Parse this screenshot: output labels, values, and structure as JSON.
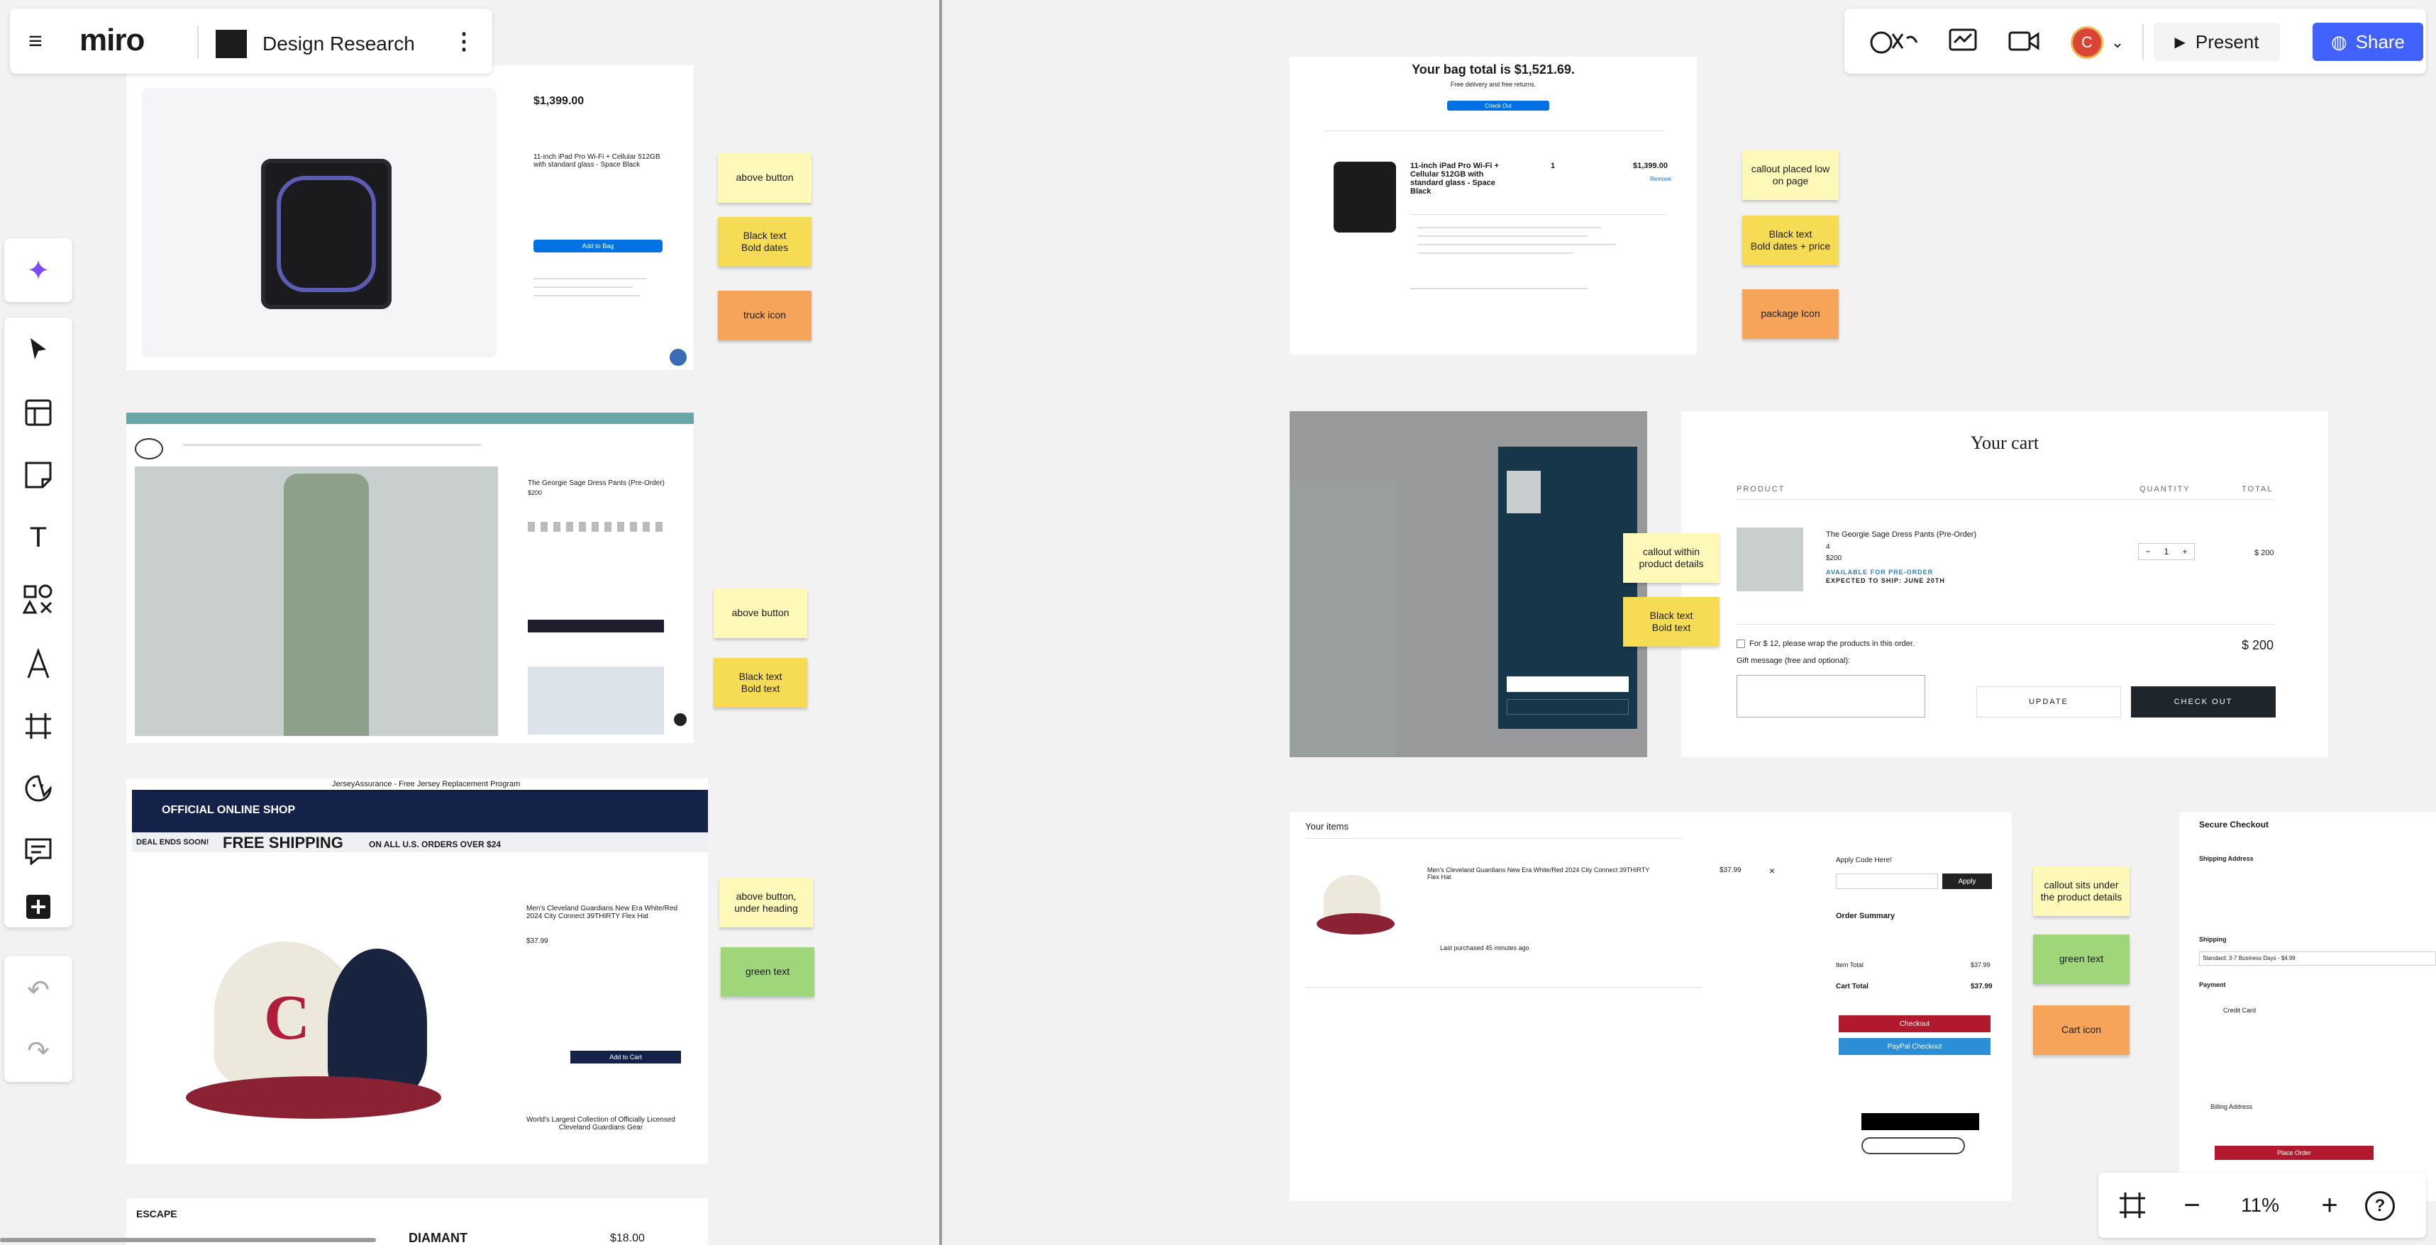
{
  "board": {
    "logo": "miro",
    "title": "Design Research"
  },
  "header": {
    "present_label": "Present",
    "share_label": "Share",
    "avatar_initial": "C"
  },
  "zoom": {
    "level": "11%"
  },
  "stickies": [
    {
      "text": "above  button",
      "color": "yellow"
    },
    {
      "text": "Black text\nBold dates",
      "color": "gold"
    },
    {
      "text": "truck icon",
      "color": "orange"
    },
    {
      "text": "above  button",
      "color": "yellow"
    },
    {
      "text": "Black text\nBold text",
      "color": "gold"
    },
    {
      "text": "above  button,\nunder heading",
      "color": "yellow"
    },
    {
      "text": "green text",
      "color": "green"
    },
    {
      "text": "callout placed low\non page",
      "color": "yellow"
    },
    {
      "text": "Black text\nBold dates + price",
      "color": "gold"
    },
    {
      "text": "package Icon",
      "color": "orange"
    },
    {
      "text": "callout within\nproduct details",
      "color": "yellow"
    },
    {
      "text": "Black text\nBold text",
      "color": "gold"
    },
    {
      "text": "callout sits under\nthe product details",
      "color": "yellow"
    },
    {
      "text": "green text",
      "color": "green"
    },
    {
      "text": "Cart icon",
      "color": "orange"
    }
  ],
  "apple_pdp": {
    "price": "$1,399.00",
    "product": "11-inch iPad Pro Wi-Fi + Cellular 512GB with standard glass - Space Black",
    "add_to_bag": "Add to Bag"
  },
  "apple_bag": {
    "title": "Your bag total is $1,521.69.",
    "subtitle": "Free delivery and free returns.",
    "checkout": "Check Out",
    "product": "11-inch iPad Pro Wi-Fi + Cellular 512GB with standard glass - Space Black",
    "qty": "1",
    "price": "$1,399.00",
    "remove": "Remove"
  },
  "suit_pdp": {
    "product": "The Georgie Sage Dress Pants (Pre-Order)",
    "price": "$200"
  },
  "cart": {
    "title": "Your cart",
    "col_product": "PRODUCT",
    "col_quantity": "QUANTITY",
    "col_total": "TOTAL",
    "item": "The Georgie Sage Dress Pants (Pre-Order)",
    "size": "4",
    "item_price": "$200",
    "preorder": "AVAILABLE FOR PRE-ORDER",
    "ship": "EXPECTED TO SHIP: JUNE 20TH",
    "line_total": "$ 200",
    "gift_wrap": "For $ 12, please wrap the products in this order.",
    "gift_msg": "Gift message (free and optional):",
    "subtotal": "$ 200",
    "update": "UPDATE",
    "checkout": "CHECK OUT",
    "qty": "1"
  },
  "mlb": {
    "banner": "JerseyAssurance - Free Jersey Replacement Program",
    "shop": "OFFICIAL ONLINE SHOP",
    "free_shipping": "FREE SHIPPING",
    "free_sub": "ON ALL U.S. ORDERS OVER $24",
    "deal": "DEAL ENDS SOON!",
    "product": "Men's Cleveland Guardians New Era White/Red 2024 City Connect 39THIRTY Flex Hat",
    "price": "$37.99",
    "add_to_cart": "Add to Cart",
    "collection": "World's Largest Collection of Officially Licensed Cleveland Guardians Gear"
  },
  "mlb_cart": {
    "heading": "Your items",
    "item": "Men's Cleveland Guardians New Era White/Red 2024 City Connect 39THIRTY Flex Hat",
    "price": "$37.99",
    "promo": "Apply Code Here!",
    "apply": "Apply",
    "summary": "Order Summary",
    "item_total": "Item Total",
    "item_total_val": "$37.99",
    "cart_total": "Cart Total",
    "cart_total_val": "$37.99",
    "checkout": "Checkout",
    "paypal": "PayPal Checkout",
    "last": "Last purchased 45 minutes ago"
  },
  "secure": {
    "title": "Secure Checkout",
    "shipping_address": "Shipping Address",
    "shipping": "Shipping",
    "shipping_val": "Standard: 3-7 Business Days - $4.99",
    "payment": "Payment",
    "credit": "Credit Card",
    "billing": "Billing Address",
    "place": "Place Order"
  },
  "escape": {
    "brand": "ESCAPE",
    "product": "DIAMANT",
    "price": "$18.00"
  }
}
